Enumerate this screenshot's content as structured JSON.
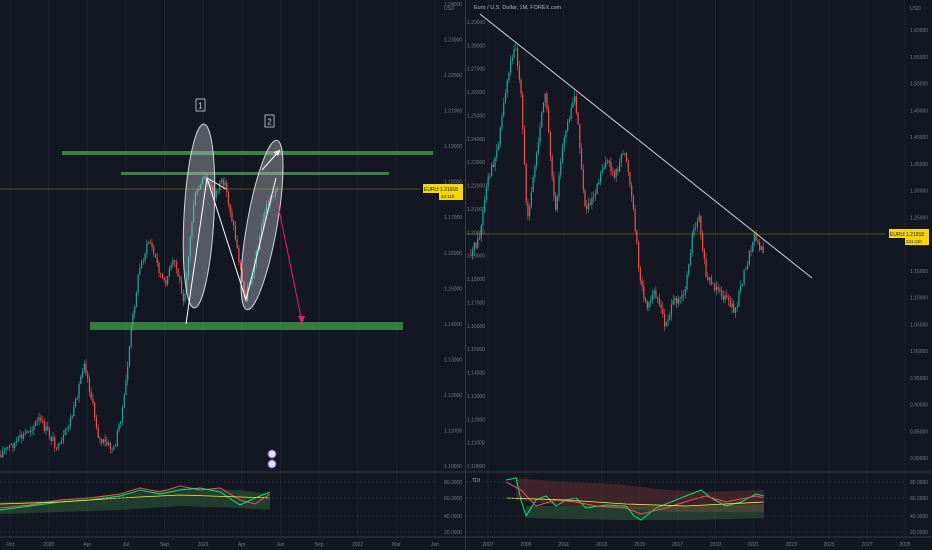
{
  "left": {
    "price_axis": [
      "1.24000",
      "1.23000",
      "1.22000",
      "1.21000",
      "1.19000",
      "1.18000",
      "1.17000",
      "1.16000",
      "1.15000",
      "1.14000",
      "1.13000",
      "1.12000",
      "1.11000",
      "1.10000"
    ],
    "price_axis_currency": "USD",
    "time_axis": [
      "Oct",
      "2020",
      "Apr",
      "Jul",
      "Sep",
      "2021",
      "Apr",
      "Jun",
      "Sep",
      "2022",
      "Mar",
      "Jun"
    ],
    "price_label": "EURUSD",
    "price_value": "1.21918",
    "price_countdown": "24:11h",
    "annotation_1": "1",
    "annotation_2": "2",
    "osc_axis": [
      "80.0000",
      "60.0000",
      "40.0000",
      "20.0000"
    ]
  },
  "right": {
    "title": "Euro / U.S. Dollar, 1M, FOREX.com",
    "price_axis": [
      "1.60000",
      "1.55000",
      "1.50000",
      "1.45000",
      "1.40000",
      "1.35000",
      "1.30000",
      "1.25000",
      "1.20000",
      "1.15000",
      "1.10000",
      "1.05000",
      "1.00000",
      "0.95000",
      "0.90000",
      "0.85000",
      "0.80000"
    ],
    "left_axis": [
      "1.29000",
      "1.28000",
      "1.27000",
      "1.26000",
      "1.25000",
      "1.24000",
      "1.23000",
      "1.22000",
      "1.21000",
      "1.20000",
      "1.19000",
      "1.18000",
      "1.17000",
      "1.16000",
      "1.15000",
      "1.14000",
      "1.13000",
      "1.12000",
      "1.11000",
      "1.10000"
    ],
    "price_axis_currency": "USD",
    "left_axis_currency": "USD",
    "time_axis": [
      "2007",
      "2009",
      "2011",
      "2013",
      "2015",
      "2017",
      "2019",
      "2021",
      "2023",
      "2025",
      "2027",
      "2029"
    ],
    "price_label": "EURUSD",
    "price_value": "1.21918",
    "price_countdown": "341:11h",
    "osc_label": "TDI",
    "osc_axis": [
      "80.0000",
      "60.0000",
      "40.0000",
      "20.0000"
    ]
  },
  "colors": {
    "background": "#131722",
    "up_candle": "#26a69a",
    "down_candle": "#ef5350",
    "support_zone": "#4caf50",
    "projection_arrow": "#e91e63",
    "price_label_bg": "#f5d60a",
    "trendline": "#d1d4dc"
  }
}
